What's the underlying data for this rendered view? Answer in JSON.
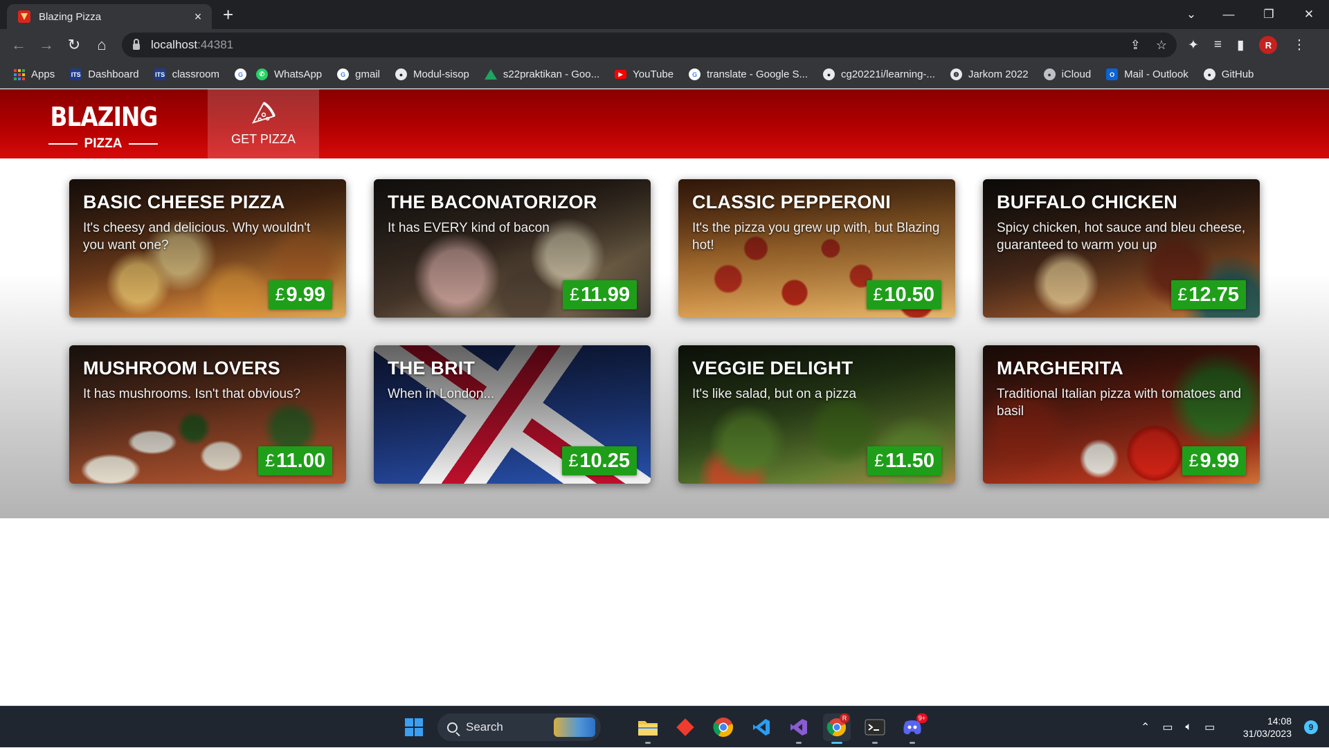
{
  "browser": {
    "tab_title": "Blazing Pizza",
    "tab_close": "×",
    "new_tab": "+",
    "url_host": "localhost",
    "url_port": ":44381",
    "profile_initial": "R",
    "window_controls": {
      "dropdown": "⌄",
      "minimize": "—",
      "restore": "❐",
      "close": "✕"
    },
    "nav": {
      "back": "←",
      "forward": "→",
      "reload": "↻",
      "home": "⌂"
    },
    "bookmarks": [
      {
        "label": "Apps",
        "icon": "apps-grid-icon"
      },
      {
        "label": "Dashboard",
        "icon": "its-icon",
        "color": "#1e3a8a"
      },
      {
        "label": "classroom",
        "icon": "its-icon",
        "color": "#1e3a8a"
      },
      {
        "label": "",
        "icon": "google-icon",
        "color": "#ffffff"
      },
      {
        "label": "WhatsApp",
        "icon": "whatsapp-icon",
        "color": "#25d366"
      },
      {
        "label": "gmail",
        "icon": "google-icon",
        "color": "#ffffff"
      },
      {
        "label": "Modul-sisop",
        "icon": "github-icon",
        "color": "#e8eaed"
      },
      {
        "label": "s22praktikan - Goo...",
        "icon": "google-drive-icon",
        "color": "#1fa463"
      },
      {
        "label": "YouTube",
        "icon": "youtube-icon",
        "color": "#ff0000"
      },
      {
        "label": "translate - Google S...",
        "icon": "google-icon",
        "color": "#ffffff"
      },
      {
        "label": "cg20221i/learning-...",
        "icon": "github-icon",
        "color": "#e8eaed"
      },
      {
        "label": "Jarkom 2022",
        "icon": "globe-icon",
        "color": "#e8eaed"
      },
      {
        "label": "iCloud",
        "icon": "apple-icon",
        "color": "#bdc1c6"
      },
      {
        "label": "Mail - Outlook",
        "icon": "outlook-icon",
        "color": "#0a64d8"
      },
      {
        "label": "GitHub",
        "icon": "github-icon",
        "color": "#e8eaed"
      }
    ]
  },
  "app": {
    "logo_main": "BLAZING",
    "logo_sub": "PIZZA",
    "nav_label": "GET PIZZA",
    "currency_symbol": "£",
    "accent_color": "#b30000",
    "price_color": "#1f9e1a",
    "specials": [
      {
        "name": "Basic Cheese Pizza",
        "description": "It's cheesy and delicious. Why wouldn't you want one?",
        "price": "9.99",
        "image_class": "bg-cheese"
      },
      {
        "name": "The Baconatorizor",
        "description": "It has EVERY kind of bacon",
        "price": "11.99",
        "image_class": "bg-bacon"
      },
      {
        "name": "Classic pepperoni",
        "description": "It's the pizza you grew up with, but Blazing hot!",
        "price": "10.50",
        "image_class": "bg-pepperoni"
      },
      {
        "name": "Buffalo chicken",
        "description": "Spicy chicken, hot sauce and bleu cheese, guaranteed to warm you up",
        "price": "12.75",
        "image_class": "bg-buffalo"
      },
      {
        "name": "Mushroom Lovers",
        "description": "It has mushrooms. Isn't that obvious?",
        "price": "11.00",
        "image_class": "bg-mushroom"
      },
      {
        "name": "The Brit",
        "description": "When in London...",
        "price": "10.25",
        "image_class": "bg-brit"
      },
      {
        "name": "Veggie Delight",
        "description": "It's like salad, but on a pizza",
        "price": "11.50",
        "image_class": "bg-veggie"
      },
      {
        "name": "Margherita",
        "description": "Traditional Italian pizza with tomatoes and basil",
        "price": "9.99",
        "image_class": "bg-margherita"
      }
    ]
  },
  "taskbar": {
    "search_label": "Search",
    "apps": [
      "windows-start-icon",
      "file-explorer-icon",
      "git-icon",
      "chrome-icon",
      "vscode-icon",
      "visual-studio-icon",
      "chrome-profile-icon",
      "terminal-icon",
      "discord-icon"
    ],
    "discord_badge": "9+",
    "chrome_profile_badge": "R",
    "time": "14:08",
    "date": "31/03/2023",
    "notification_count": "9"
  }
}
